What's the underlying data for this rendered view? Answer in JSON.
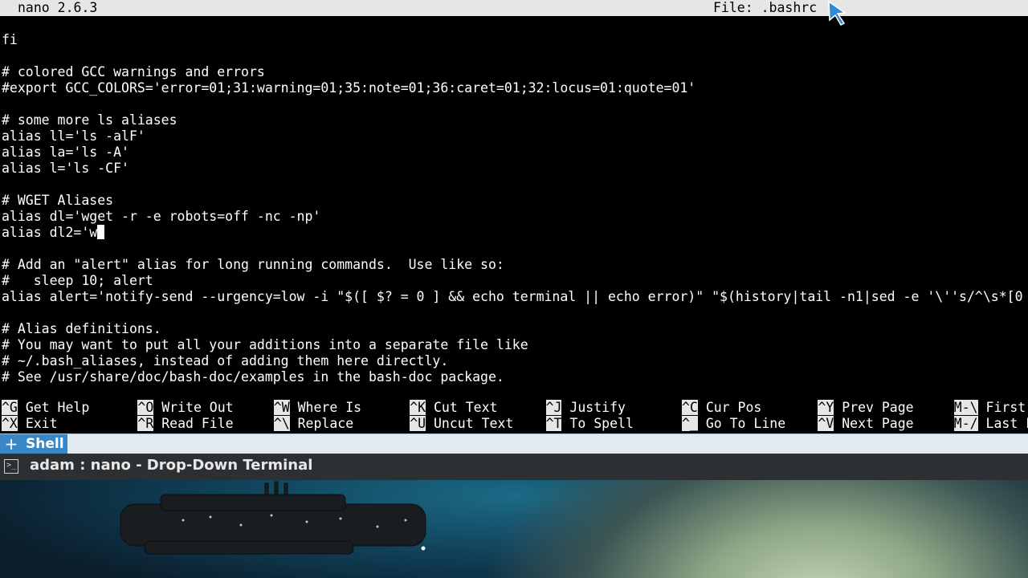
{
  "nano": {
    "version": "nano 2.6.3",
    "file_label": "File: .bashrc"
  },
  "editor_lines": [
    "fi",
    "",
    "# colored GCC warnings and errors",
    "#export GCC_COLORS='error=01;31:warning=01;35:note=01;36:caret=01;32:locus=01:quote=01'",
    "",
    "# some more ls aliases",
    "alias ll='ls -alF'",
    "alias la='ls -A'",
    "alias l='ls -CF'",
    "",
    "# WGET Aliases",
    "alias dl='wget -r -e robots=off -nc -np'",
    "alias dl2='w",
    "",
    "# Add an \"alert\" alias for long running commands.  Use like so:",
    "#   sleep 10; alert",
    "alias alert='notify-send --urgency=low -i \"$([ $? = 0 ] && echo terminal || echo error)\" \"$(history|tail -n1|sed -e '\\''s/^\\s*[0",
    "",
    "# Alias definitions.",
    "# You may want to put all your additions into a separate file like",
    "# ~/.bash_aliases, instead of adding them here directly.",
    "# See /usr/share/doc/bash-doc/examples in the bash-doc package."
  ],
  "shortcuts": [
    {
      "key": "^G",
      "label": "Get Help"
    },
    {
      "key": "^X",
      "label": "Exit"
    },
    {
      "key": "^O",
      "label": "Write Out"
    },
    {
      "key": "^R",
      "label": "Read File"
    },
    {
      "key": "^W",
      "label": "Where Is"
    },
    {
      "key": "^\\",
      "label": "Replace"
    },
    {
      "key": "^K",
      "label": "Cut Text"
    },
    {
      "key": "^U",
      "label": "Uncut Text"
    },
    {
      "key": "^J",
      "label": "Justify"
    },
    {
      "key": "^T",
      "label": "To Spell"
    },
    {
      "key": "^C",
      "label": "Cur Pos"
    },
    {
      "key": "^_",
      "label": "Go To Line"
    },
    {
      "key": "^Y",
      "label": "Prev Page"
    },
    {
      "key": "^V",
      "label": "Next Page"
    },
    {
      "key": "M-\\",
      "label": "First"
    },
    {
      "key": "M-/",
      "label": "Last L"
    }
  ],
  "shell_tab": {
    "icon": "plus-icon",
    "label": "Shell"
  },
  "window": {
    "icon": "terminal-icon",
    "title": "adam : nano - Drop-Down Terminal"
  },
  "colors": {
    "terminal_bg": "#000000",
    "terminal_fg": "#ffffff",
    "nano_bar_bg": "#e6e6e6",
    "tab_accent": "#3b86c6",
    "window_title_bg": "#2d3033"
  }
}
